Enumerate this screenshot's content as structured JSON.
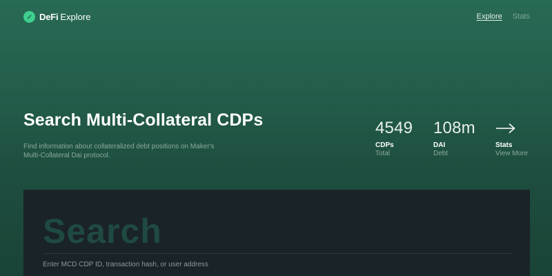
{
  "brand": {
    "name_bold": "DeFi",
    "name_light": "Explore",
    "icon": "compass-icon"
  },
  "nav": {
    "items": [
      {
        "label": "Explore",
        "active": true
      },
      {
        "label": "Stats",
        "active": false
      }
    ]
  },
  "hero": {
    "title": "Search Multi-Collateral CDPs",
    "description": "Find information about collateralized debt positions on Maker's Multi-Collateral Dai protocol."
  },
  "stats": {
    "cdps": {
      "value": "4549",
      "label": "CDPs",
      "sub": "Total"
    },
    "dai": {
      "value": "108m",
      "label": "DAI",
      "sub": "Debt"
    },
    "more": {
      "icon": "arrow-right-icon",
      "label": "Stats",
      "sub": "View More"
    }
  },
  "search": {
    "heading": "Search",
    "placeholder": "Enter MCD CDP ID, transaction hash, or user address"
  },
  "colors": {
    "accent": "#3fcf8e",
    "background_top": "#286a55",
    "background_bottom": "#1a4337",
    "panel": "#1a2328",
    "search_heading": "#1f4a42"
  }
}
